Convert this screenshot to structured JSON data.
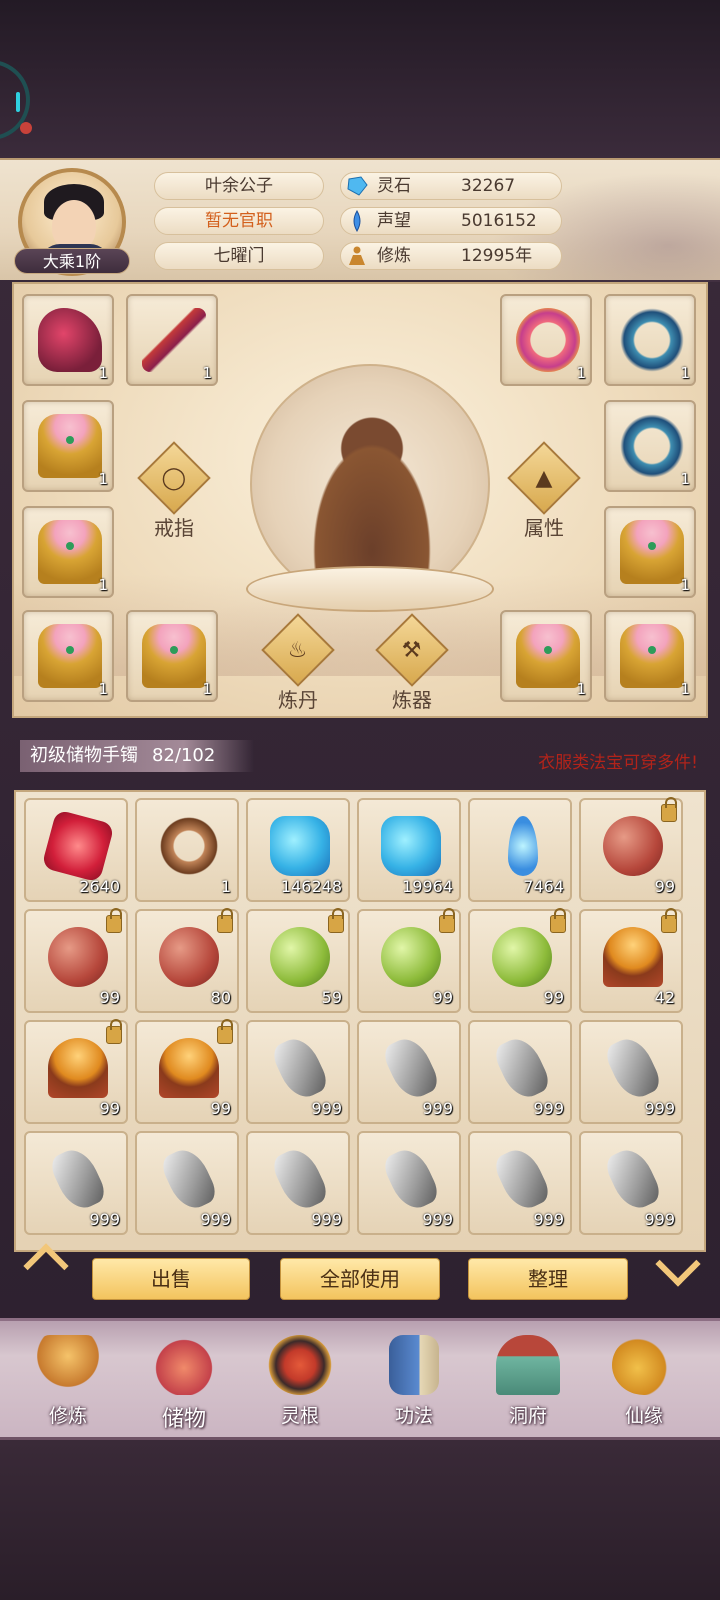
{
  "player": {
    "name": "叶余公子",
    "title": "暂无官职",
    "sect": "七曜门",
    "rank": "大乘1阶"
  },
  "resources": [
    {
      "icon": "spirit-stone-icon",
      "label": "灵石",
      "value": "32267"
    },
    {
      "icon": "prestige-icon",
      "label": "声望",
      "value": "5016152"
    },
    {
      "icon": "cultivation-icon",
      "label": "修炼",
      "value": "12995年"
    }
  ],
  "equipment": {
    "left_top": [
      {
        "item": "boots",
        "count": "1"
      },
      {
        "item": "sword",
        "count": "1"
      }
    ],
    "left_col": [
      {
        "item": "robe",
        "count": "1"
      },
      {
        "item": "robe",
        "count": "1"
      },
      {
        "item": "robe",
        "count": "1"
      }
    ],
    "left_bottom_2": {
      "item": "robe",
      "count": "1"
    },
    "right_top": [
      {
        "item": "ring-pink",
        "count": "1"
      },
      {
        "item": "ring-blue",
        "count": "1"
      }
    ],
    "right_col": [
      {
        "item": "ring-blue",
        "count": "1"
      },
      {
        "item": "robe",
        "count": "1"
      },
      {
        "item": "robe",
        "count": "1"
      }
    ],
    "right_bottom_2": {
      "item": "robe",
      "count": "1"
    }
  },
  "functions": {
    "ring": "戒指",
    "attributes": "属性",
    "alchemy": "炼丹",
    "forging": "炼器"
  },
  "storage": {
    "name": "初级储物手镯",
    "capacity": "82/102",
    "hint": "衣服类法宝可穿多件!"
  },
  "items": [
    {
      "type": "red-gem",
      "count": "2640",
      "locked": false
    },
    {
      "type": "brown-ring",
      "count": "1",
      "locked": false
    },
    {
      "type": "blue-stone",
      "count": "146248",
      "locked": false
    },
    {
      "type": "blue-stone",
      "count": "19964",
      "locked": false
    },
    {
      "type": "blue-feather",
      "count": "7464",
      "locked": false
    },
    {
      "type": "red-orb",
      "count": "99",
      "locked": true
    },
    {
      "type": "red-orb",
      "count": "99",
      "locked": true
    },
    {
      "type": "red-orb",
      "count": "80",
      "locked": true
    },
    {
      "type": "green-orb",
      "count": "59",
      "locked": true
    },
    {
      "type": "green-orb",
      "count": "99",
      "locked": true
    },
    {
      "type": "green-orb",
      "count": "99",
      "locked": true
    },
    {
      "type": "orb-on-stand",
      "count": "42",
      "locked": true
    },
    {
      "type": "orb-on-stand",
      "count": "99",
      "locked": true
    },
    {
      "type": "orb-on-stand",
      "count": "99",
      "locked": true
    },
    {
      "type": "ore",
      "count": "999",
      "locked": false
    },
    {
      "type": "ore",
      "count": "999",
      "locked": false
    },
    {
      "type": "ore",
      "count": "999",
      "locked": false
    },
    {
      "type": "ore",
      "count": "999",
      "locked": false
    },
    {
      "type": "ore",
      "count": "999",
      "locked": false
    },
    {
      "type": "ore",
      "count": "999",
      "locked": false
    },
    {
      "type": "ore",
      "count": "999",
      "locked": false
    },
    {
      "type": "ore",
      "count": "999",
      "locked": false
    },
    {
      "type": "ore",
      "count": "999",
      "locked": false
    },
    {
      "type": "ore",
      "count": "999",
      "locked": false
    }
  ],
  "actions": {
    "sell": "出售",
    "use_all": "全部使用",
    "sort": "整理"
  },
  "nav": [
    {
      "label": "修炼",
      "icon": "cultivate-icon"
    },
    {
      "label": "储物",
      "icon": "storage-bag-icon",
      "active": true
    },
    {
      "label": "灵根",
      "icon": "spirit-root-icon"
    },
    {
      "label": "功法",
      "icon": "technique-book-icon"
    },
    {
      "label": "洞府",
      "icon": "cave-dwelling-icon"
    },
    {
      "label": "仙缘",
      "icon": "immortal-fate-icon"
    }
  ]
}
